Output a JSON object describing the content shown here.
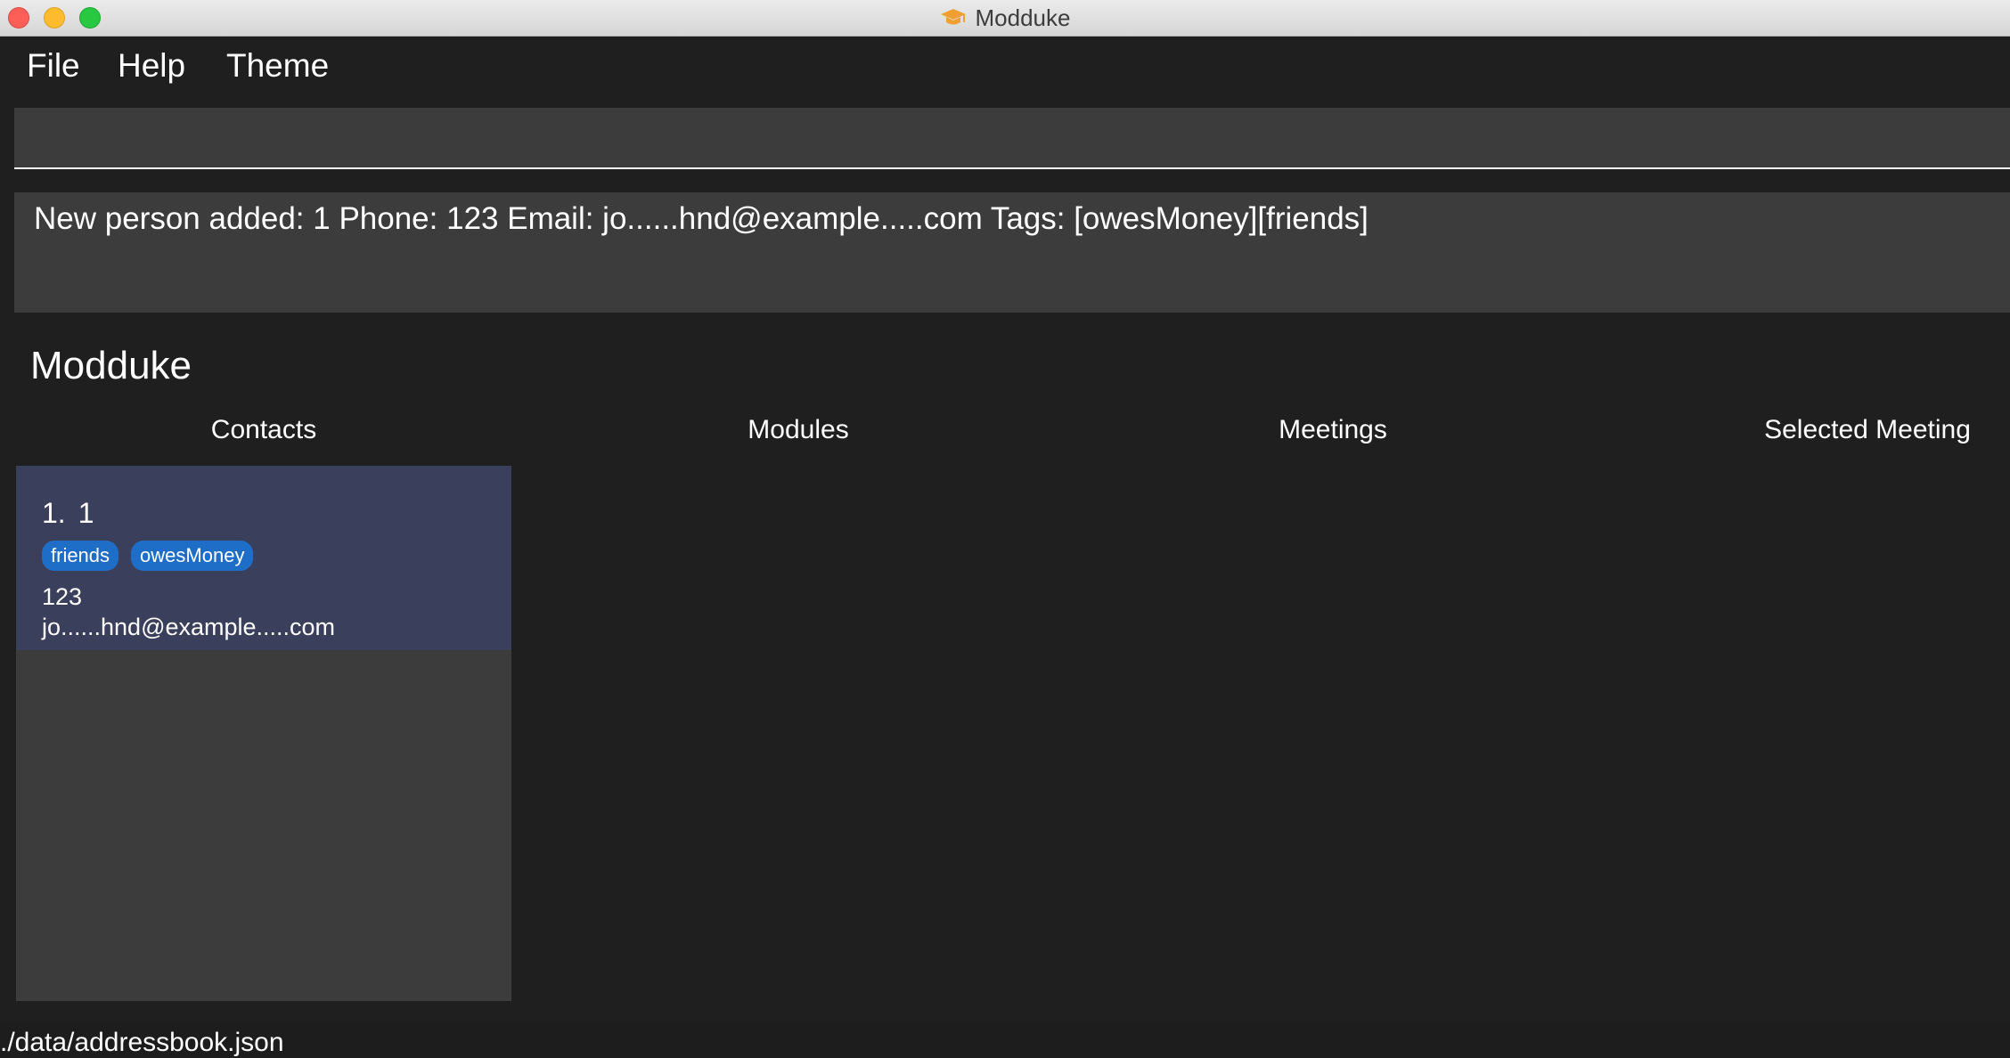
{
  "window": {
    "title": "Modduke",
    "title_icon": "graduation-cap-icon"
  },
  "menu": {
    "items": [
      {
        "label": "File"
      },
      {
        "label": "Help"
      },
      {
        "label": "Theme"
      }
    ]
  },
  "command_box": {
    "value": "",
    "placeholder": ""
  },
  "result_display": {
    "text": "New person added: 1 Phone: 123 Email: jo......hnd@example.....com Tags: [owesMoney][friends]"
  },
  "heading": "Modduke",
  "sections": {
    "contacts": "Contacts",
    "modules": "Modules",
    "meetings": "Meetings",
    "selected_meeting": "Selected Meeting"
  },
  "contacts": [
    {
      "index": "1.",
      "name": "1",
      "tags": [
        "friends",
        "owesMoney"
      ],
      "phone": "123",
      "email": "jo......hnd@example.....com"
    }
  ],
  "status_bar": {
    "path": "./data/addressbook.json"
  },
  "colors": {
    "background": "#1f1f1f",
    "panel": "#3c3c3c",
    "selected_card": "#3a3f5c",
    "tag": "#1e6ec8",
    "icon_accent": "#f0a030"
  }
}
